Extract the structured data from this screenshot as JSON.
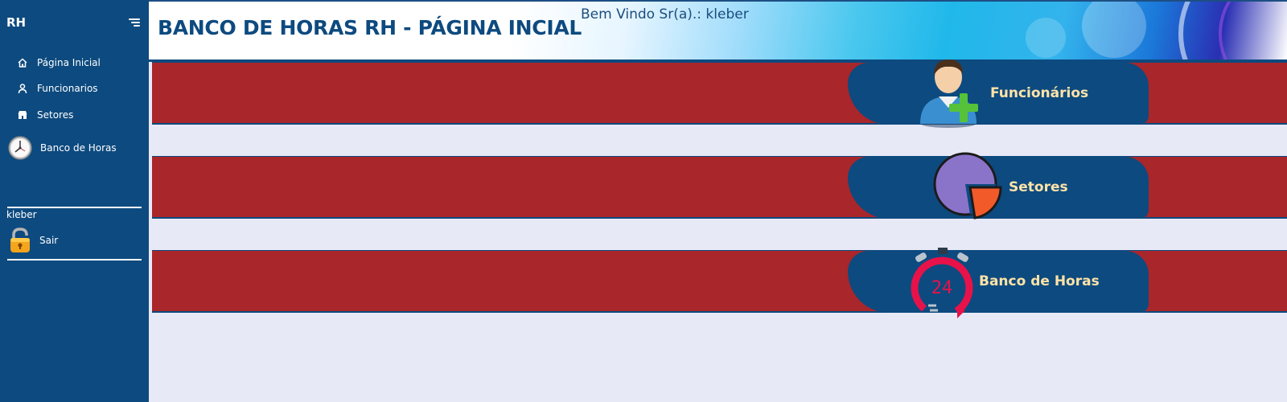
{
  "app": {
    "brand": "RH"
  },
  "sidebar": {
    "items": [
      {
        "label": "Página Inicial",
        "icon": "home-icon"
      },
      {
        "label": "Funcionarios",
        "icon": "user-icon"
      },
      {
        "label": "Setores",
        "icon": "building-icon"
      },
      {
        "label": "Banco de Horas",
        "icon": "clock-icon"
      }
    ],
    "username": "kleber",
    "logout_label": "Sair",
    "logout_icon": "lock-icon"
  },
  "header": {
    "title": "BANCO DE HORAS RH - PÁGINA INCIAL",
    "welcome": "Bem Vindo Sr(a).: kleber"
  },
  "main": {
    "cards": [
      {
        "label": "Funcionários",
        "icon": "add-user-icon"
      },
      {
        "label": "Setores",
        "icon": "pie-chart-icon"
      },
      {
        "label": "Banco de Horas",
        "icon": "stopwatch-24-icon",
        "icon_text": "24"
      }
    ]
  },
  "colors": {
    "sidebar": "#0d4a7f",
    "row": "#a9262b",
    "pill": "#0d4a7f",
    "pill_text": "#ffe3a8",
    "page_bg": "#e8e9f6"
  }
}
